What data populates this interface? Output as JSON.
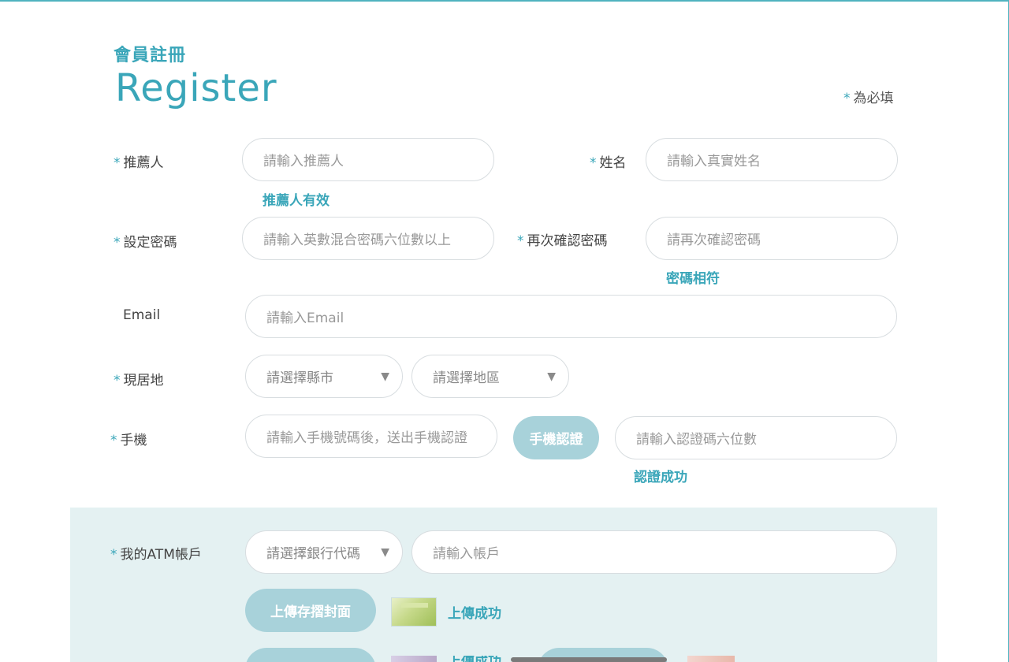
{
  "header": {
    "title_zh": "會員註冊",
    "title_en": "Register",
    "required_note": "為必填",
    "required_mark": "*"
  },
  "form": {
    "referrer": {
      "label": "推薦人",
      "placeholder": "請輸入推薦人",
      "status": "推薦人有效"
    },
    "name": {
      "label": "姓名",
      "placeholder": "請輸入真實姓名"
    },
    "password": {
      "label": "設定密碼",
      "placeholder": "請輸入英數混合密碼六位數以上"
    },
    "password_confirm": {
      "label": "再次確認密碼",
      "placeholder": "請再次確認密碼",
      "status": "密碼相符"
    },
    "email": {
      "label": "Email",
      "placeholder": "請輸入Email"
    },
    "location": {
      "label": "現居地",
      "city_placeholder": "請選擇縣市",
      "district_placeholder": "請選擇地區"
    },
    "phone": {
      "label": "手機",
      "placeholder": "請輸入手機號碼後，送出手機認證",
      "verify_button": "手機認證",
      "code_placeholder": "請輸入認證碼六位數",
      "status": "認證成功"
    },
    "atm": {
      "label": "我的ATM帳戶",
      "bank_placeholder": "請選擇銀行代碼",
      "account_placeholder": "請輸入帳戶",
      "upload_button": "上傳存摺封面",
      "upload_status": "上傳成功"
    },
    "partial_row": {
      "upload_status": "上傳成功"
    }
  },
  "icons": {
    "dropdown": "chevron-down-icon"
  },
  "colors": {
    "accent": "#3aa6b9",
    "button": "#a8d2da",
    "band": "#e4f1f2",
    "border": "#d8dde0"
  }
}
